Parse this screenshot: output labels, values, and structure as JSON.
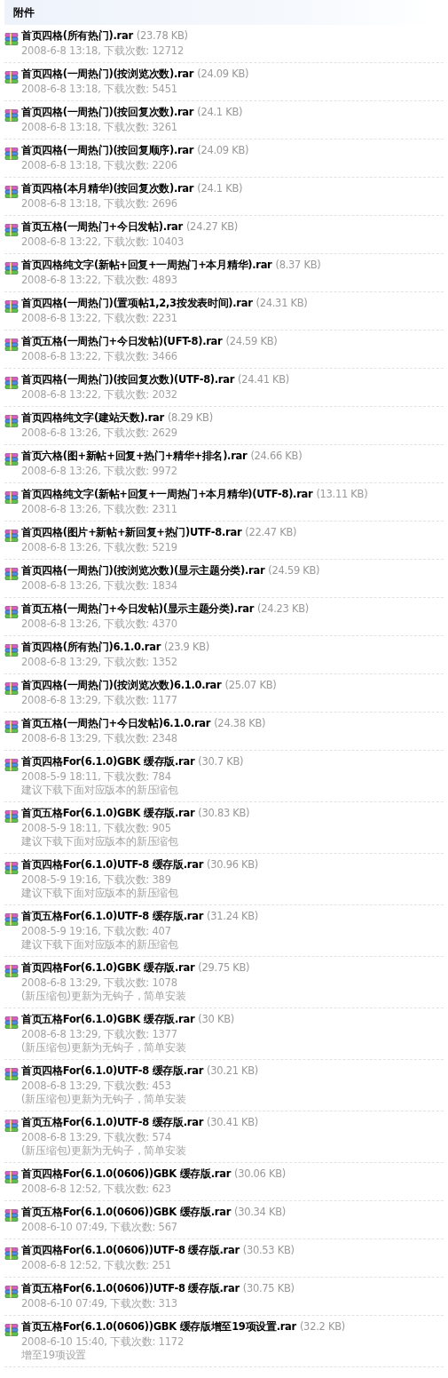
{
  "section": {
    "title": "附件"
  },
  "attachments": [
    {
      "name": "首页四格(所有热门).rar",
      "size": "(23.78 KB)",
      "meta": "2008-6-8 13:18, 下载次数: 12712"
    },
    {
      "name": "首页四格(一周热门)(按浏览次数).rar",
      "size": "(24.09 KB)",
      "meta": "2008-6-8 13:18, 下载次数: 5451"
    },
    {
      "name": "首页四格(一周热门)(按回复次数).rar",
      "size": "(24.1 KB)",
      "meta": "2008-6-8 13:18, 下载次数: 3261"
    },
    {
      "name": "首页四格(一周热门)(按回复顺序).rar",
      "size": "(24.09 KB)",
      "meta": "2008-6-8 13:18, 下载次数: 2206"
    },
    {
      "name": "首页四格(本月精华)(按回复次数).rar",
      "size": "(24.1 KB)",
      "meta": "2008-6-8 13:18, 下载次数: 2696"
    },
    {
      "name": "首页五格(一周热门+今日发帖).rar",
      "size": "(24.27 KB)",
      "meta": "2008-6-8 13:22, 下载次数: 10403"
    },
    {
      "name": "首页四格纯文字(新帖+回复+一周热门+本月精华).rar",
      "size": "(8.37 KB)",
      "meta": "2008-6-8 13:22, 下载次数: 4893"
    },
    {
      "name": "首页四格(一周热门)(置项帖1,2,3按发表时间).rar",
      "size": "(24.31 KB)",
      "meta": "2008-6-8 13:22, 下载次数: 2231"
    },
    {
      "name": "首页五格(一周热门+今日发帖)(UFT-8).rar",
      "size": "(24.59 KB)",
      "meta": "2008-6-8 13:22, 下载次数: 3466"
    },
    {
      "name": "首页四格(一周热门)(按回复次数)(UTF-8).rar",
      "size": "(24.41 KB)",
      "meta": "2008-6-8 13:22, 下载次数: 2032"
    },
    {
      "name": "首页四格纯文字(建站天数).rar",
      "size": "(8.29 KB)",
      "meta": "2008-6-8 13:26, 下载次数: 2629"
    },
    {
      "name": "首页六格(图+新帖+回复+热门+精华+排名).rar",
      "size": "(24.66 KB)",
      "meta": "2008-6-8 13:26, 下载次数: 9972"
    },
    {
      "name": "首页四格纯文字(新帖+回复+一周热门+本月精华)(UTF-8).rar",
      "size": "(13.11 KB)",
      "meta": "2008-6-8 13:26, 下载次数: 2311"
    },
    {
      "name": "首页四格(图片+新帖+新回复+热门)UTF-8.rar",
      "size": "(22.47 KB)",
      "meta": "2008-6-8 13:26, 下载次数: 5219"
    },
    {
      "name": "首页四格(一周热门)(按浏览次数)(显示主题分类).rar",
      "size": "(24.59 KB)",
      "meta": "2008-6-8 13:26, 下载次数: 1834"
    },
    {
      "name": "首页五格(一周热门+今日发帖)(显示主题分类).rar",
      "size": "(24.23 KB)",
      "meta": "2008-6-8 13:26, 下载次数: 4370"
    },
    {
      "name": "首页四格(所有热门)6.1.0.rar",
      "size": "(23.9 KB)",
      "meta": "2008-6-8 13:29, 下载次数: 1352"
    },
    {
      "name": "首页四格(一周热门)(按浏览次数)6.1.0.rar",
      "size": "(25.07 KB)",
      "meta": "2008-6-8 13:29, 下载次数: 1177"
    },
    {
      "name": "首页五格(一周热门+今日发帖)6.1.0.rar",
      "size": "(24.38 KB)",
      "meta": "2008-6-8 13:29, 下载次数: 2348"
    },
    {
      "name": "首页四格For(6.1.0)GBK 缓存版.rar",
      "size": "(30.7 KB)",
      "meta": "2008-5-9 18:11, 下载次数: 784",
      "note": "建议下载下面对应版本的新压缩包"
    },
    {
      "name": "首页五格For(6.1.0)GBK 缓存版.rar",
      "size": "(30.83 KB)",
      "meta": "2008-5-9 18:11, 下载次数: 905",
      "note": "建议下载下面对应版本的新压缩包"
    },
    {
      "name": "首页四格For(6.1.0)UTF-8 缓存版.rar",
      "size": "(30.96 KB)",
      "meta": "2008-5-9 19:16, 下载次数: 389",
      "note": "建议下载下面对应版本的新压缩包"
    },
    {
      "name": "首页五格For(6.1.0)UTF-8 缓存版.rar",
      "size": "(31.24 KB)",
      "meta": "2008-5-9 19:16, 下载次数: 407",
      "note": "建议下载下面对应版本的新压缩包"
    },
    {
      "name": "首页四格For(6.1.0)GBK 缓存版.rar",
      "size": "(29.75 KB)",
      "meta": "2008-6-8 13:29, 下载次数: 1078",
      "note": "(新压缩包)更新为无钩子，简单安装"
    },
    {
      "name": "首页五格For(6.1.0)GBK 缓存版.rar",
      "size": "(30 KB)",
      "meta": "2008-6-8 13:29, 下载次数: 1377",
      "note": "(新压缩包)更新为无钩子，简单安装"
    },
    {
      "name": "首页四格For(6.1.0)UTF-8 缓存版.rar",
      "size": "(30.21 KB)",
      "meta": "2008-6-8 13:29, 下载次数: 453",
      "note": "(新压缩包)更新为无钩子，简单安装"
    },
    {
      "name": "首页五格For(6.1.0)UTF-8 缓存版.rar",
      "size": "(30.41 KB)",
      "meta": "2008-6-8 13:29, 下载次数: 574",
      "note": "(新压缩包)更新为无钩子，简单安装"
    },
    {
      "name": "首页四格For(6.1.0(0606))GBK 缓存版.rar",
      "size": "(30.06 KB)",
      "meta": "2008-6-8 12:52, 下载次数: 623"
    },
    {
      "name": "首页五格For(6.1.0(0606))GBK 缓存版.rar",
      "size": "(30.34 KB)",
      "meta": "2008-6-10 07:49, 下载次数: 567"
    },
    {
      "name": "首页四格For(6.1.0(0606))UTF-8 缓存版.rar",
      "size": "(30.53 KB)",
      "meta": "2008-6-8 12:52, 下载次数: 251"
    },
    {
      "name": "首页五格For(6.1.0(0606))UTF-8 缓存版.rar",
      "size": "(30.75 KB)",
      "meta": "2008-6-10 07:49, 下载次数: 313"
    },
    {
      "name": "首页五格For(6.1.0(0606))GBK 缓存版增至19项设置.rar",
      "size": "(32.2 KB)",
      "meta": "2008-6-10 15:40, 下载次数: 1172",
      "note": "增至19项设置"
    }
  ]
}
